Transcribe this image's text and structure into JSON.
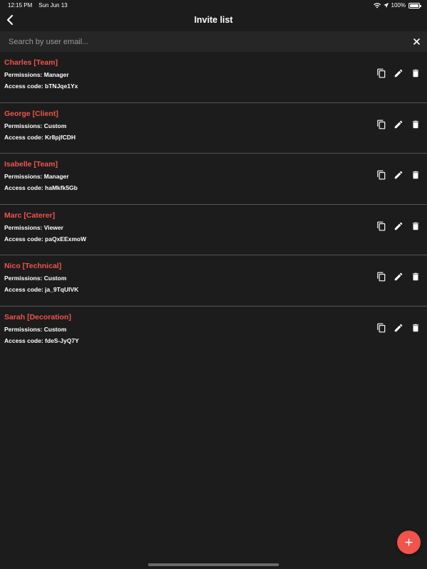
{
  "status_bar": {
    "time": "12:15 PM",
    "date": "Sun Jun 13",
    "battery": "100%"
  },
  "header": {
    "title": "Invite list",
    "back_icon": "chevron-left-icon"
  },
  "search": {
    "placeholder": "Search by user email...",
    "value": "",
    "clear_icon": "close-icon"
  },
  "invites": [
    {
      "name": "Charles [Team]",
      "permissions": "Permissions: Manager",
      "code": "Access code: bTNJqe1Yx"
    },
    {
      "name": "George [Client]",
      "permissions": "Permissions: Custom",
      "code": "Access code: Kr8pjfCDH"
    },
    {
      "name": "Isabelle [Team]",
      "permissions": "Permissions: Manager",
      "code": "Access code: haMkfk5Gb"
    },
    {
      "name": "Marc [Caterer]",
      "permissions": "Permissions: Viewer",
      "code": "Access code: paQxEExmoW"
    },
    {
      "name": "Nico [Technical]",
      "permissions": "Permissions: Custom",
      "code": "Access code: ja_9TqUIVK"
    },
    {
      "name": "Sarah [Decoration]",
      "permissions": "Permissions: Custom",
      "code": "Access code: fdeS-JyQ7Y"
    }
  ],
  "actions": {
    "copy_icon": "copy-icon",
    "edit_icon": "pencil-icon",
    "delete_icon": "trash-icon"
  },
  "fab": {
    "label": "+",
    "icon": "plus-icon"
  },
  "colors": {
    "background": "#1c1c1c",
    "search_bg": "#262626",
    "accent": "#f0544c",
    "divider": "#555555"
  }
}
